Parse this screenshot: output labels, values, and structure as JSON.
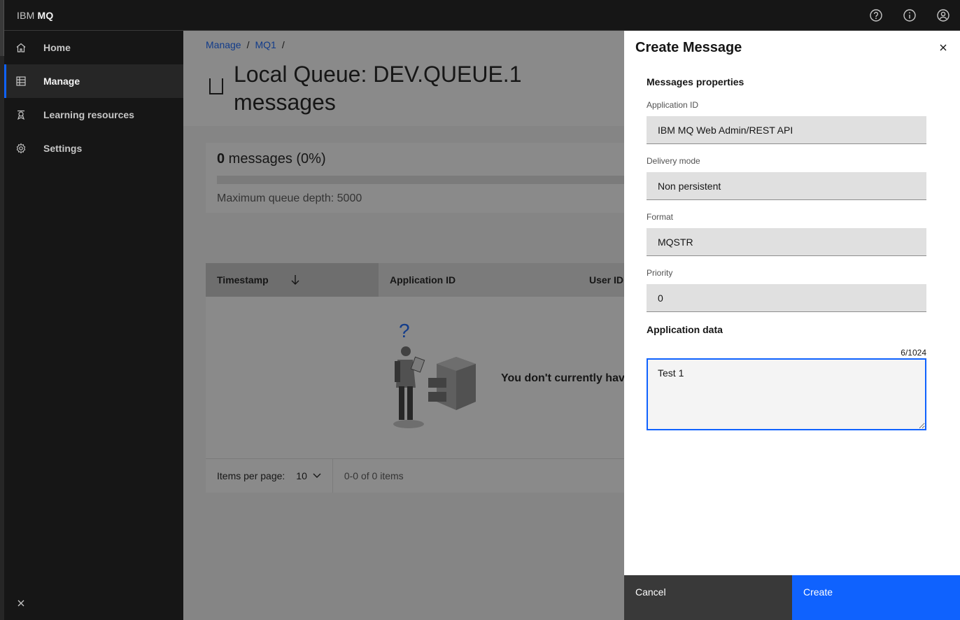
{
  "header": {
    "brand_prefix": "IBM",
    "brand_product": "MQ",
    "actions": [
      "help-icon",
      "info-icon",
      "user-avatar-icon"
    ]
  },
  "sidenav": {
    "items": [
      {
        "label": "Home",
        "icon": "home-icon"
      },
      {
        "label": "Manage",
        "icon": "table-icon",
        "active": true
      },
      {
        "label": "Learning resources",
        "icon": "learning-icon"
      },
      {
        "label": "Settings",
        "icon": "gear-icon"
      }
    ]
  },
  "main": {
    "breadcrumb": [
      "Manage",
      "MQ1"
    ],
    "breadcrumb_sep": "/",
    "title": "Local Queue: DEV.QUEUE.1 messages",
    "depth": {
      "count": "0",
      "count_suffix": " messages (0%)",
      "max_label": "Maximum queue depth: 5000",
      "fill_fraction": 0
    },
    "table": {
      "columns": [
        "Timestamp",
        "Application ID",
        "User ID"
      ],
      "empty_message": "You don't currently have"
    },
    "pagination": {
      "items_per_page_label": "Items per page:",
      "items_per_page_value": "10",
      "range": "0-0 of 0 items"
    }
  },
  "panel": {
    "title": "Create Message",
    "section_properties": "Messages properties",
    "fields": {
      "application_id": {
        "label": "Application ID",
        "value": "IBM MQ Web Admin/REST API"
      },
      "delivery_mode": {
        "label": "Delivery mode",
        "value": "Non persistent"
      },
      "format": {
        "label": "Format",
        "value": "MQSTR"
      },
      "priority": {
        "label": "Priority",
        "value": "0"
      }
    },
    "section_data": "Application data",
    "data_counter": "6/1024",
    "data_value": "Test 1",
    "cancel_label": "Cancel",
    "create_label": "Create"
  },
  "colors": {
    "accent": "#0f62fe",
    "shell": "#161616"
  }
}
